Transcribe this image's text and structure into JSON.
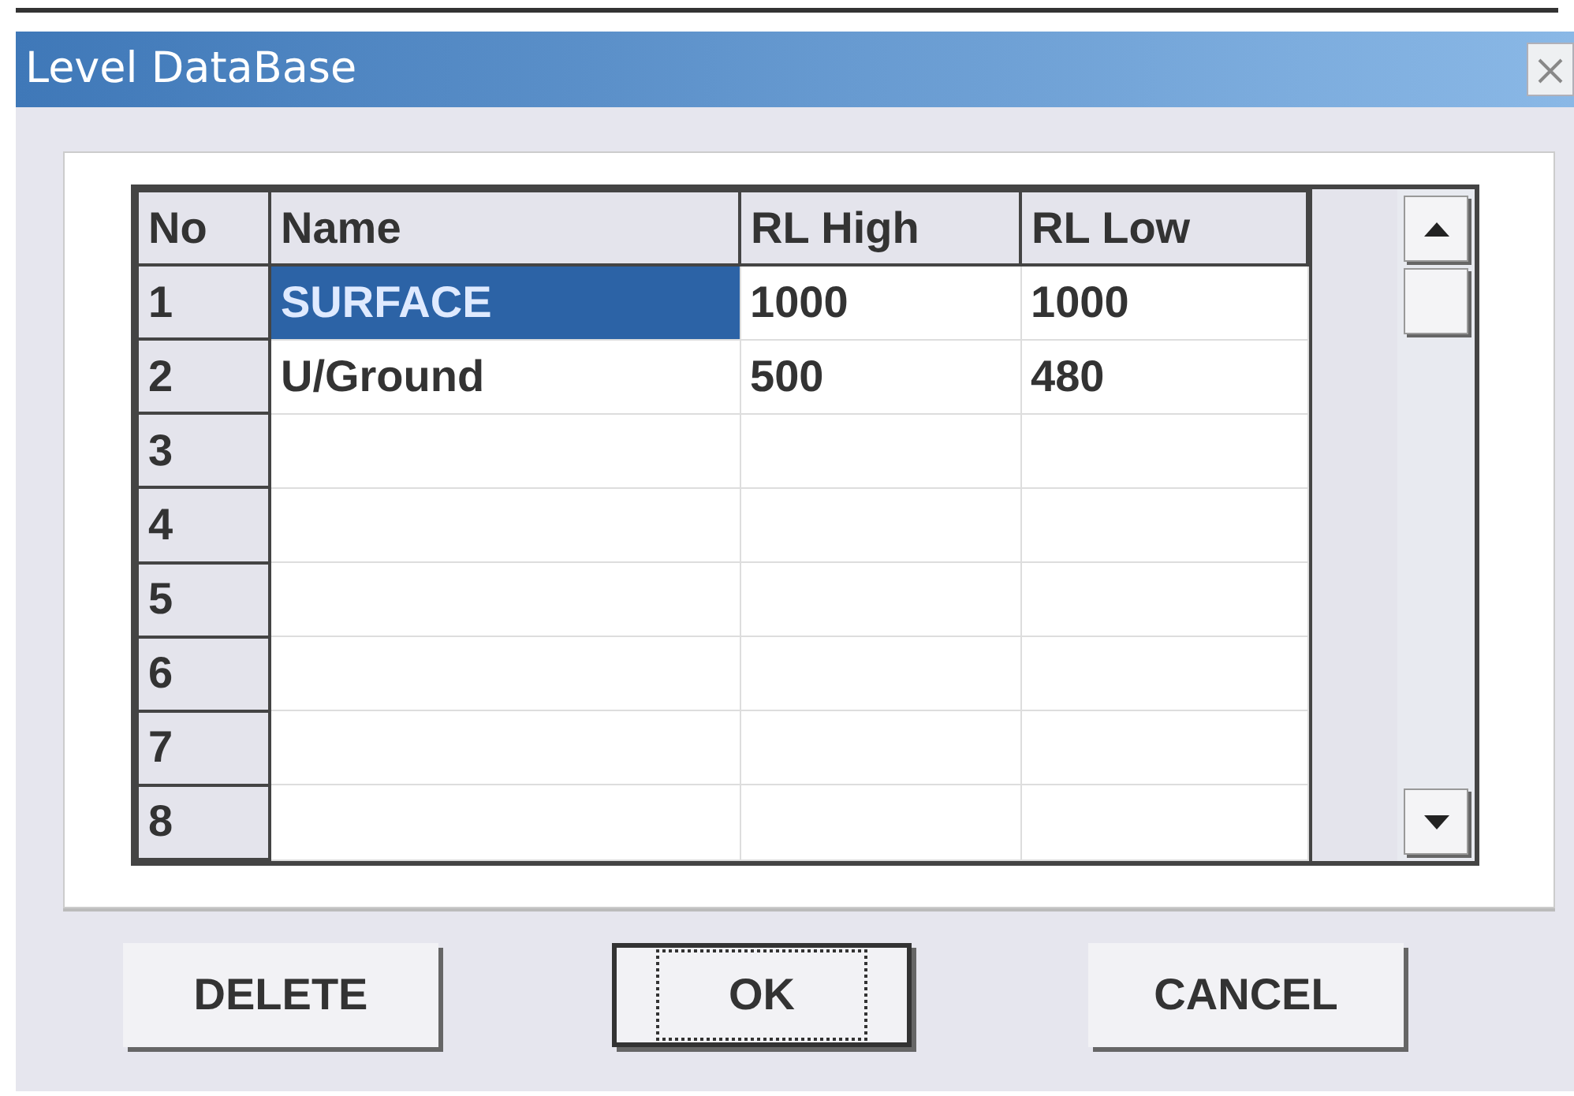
{
  "window": {
    "title": "Level DataBase"
  },
  "table": {
    "columns": [
      "No",
      "Name",
      "RL High",
      "RL Low"
    ],
    "rows": [
      {
        "no": "1",
        "name": "SURFACE",
        "rl_high": "1000",
        "rl_low": "1000",
        "selected": true
      },
      {
        "no": "2",
        "name": "U/Ground",
        "rl_high": "500",
        "rl_low": "480",
        "selected": false
      },
      {
        "no": "3",
        "selected": false
      },
      {
        "no": "4",
        "selected": false
      },
      {
        "no": "5",
        "selected": false
      },
      {
        "no": "6",
        "selected": false
      },
      {
        "no": "7",
        "selected": false
      },
      {
        "no": "8",
        "selected": false
      }
    ]
  },
  "buttons": [
    {
      "label": "DELETE",
      "focused": false
    },
    {
      "label": "OK",
      "focused": true
    },
    {
      "label": "CANCEL",
      "focused": false
    }
  ]
}
